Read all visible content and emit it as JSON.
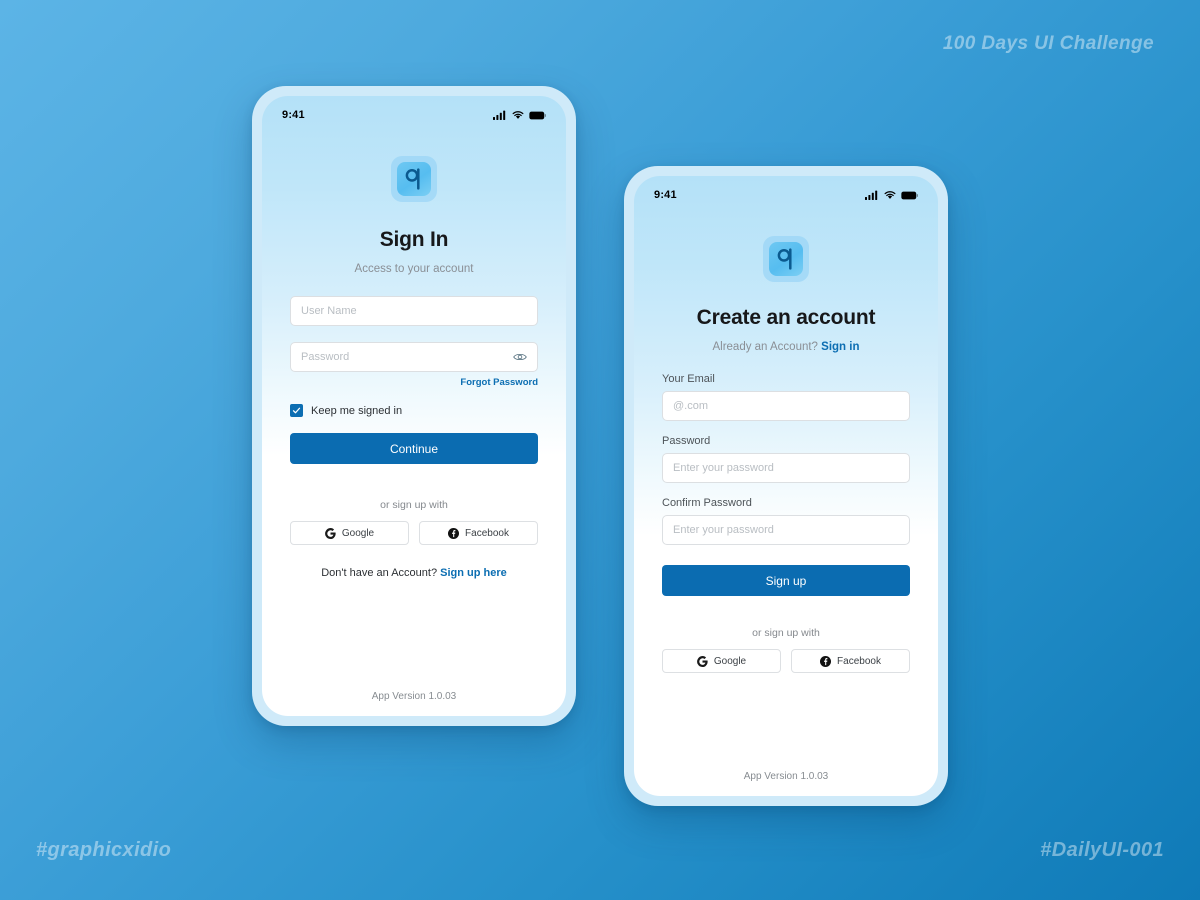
{
  "watermarks": {
    "top_right": "100 Days UI Challenge",
    "bottom_left": "#graphicxidio",
    "bottom_right": "#DailyUI-001"
  },
  "colors": {
    "background_from": "#5cb4e6",
    "background_to": "#0f7ab7",
    "accent": "#0b6cb1",
    "link": "#0c6eb2",
    "bezel": "#cfeaf9",
    "logo_tile": "#56bdf0",
    "logo_glyph": "#0b5a8f",
    "placeholder": "#b9bec3"
  },
  "signin": {
    "status": {
      "time": "9:41",
      "cellular_icon": "signal-bars-icon",
      "wifi_icon": "wifi-icon",
      "battery_icon": "battery-icon"
    },
    "logo_icon": "app-logo-icon",
    "title": "Sign In",
    "subtitle": "Access to your account",
    "username": {
      "placeholder": "User Name",
      "value": ""
    },
    "password": {
      "placeholder": "Password",
      "value": "",
      "toggle_icon": "eye-icon"
    },
    "forgot_label": "Forgot Password",
    "remember": {
      "label": "Keep me signed in",
      "checked": true,
      "check_icon": "check-icon"
    },
    "submit_label": "Continue",
    "divider_label": "or sign up with",
    "social": [
      {
        "label": "Google",
        "icon": "google-icon"
      },
      {
        "label": "Facebook",
        "icon": "facebook-icon"
      }
    ],
    "cta_text": "Don't have an Account?",
    "cta_link": "Sign up here",
    "version": "App Version 1.0.03"
  },
  "signup": {
    "status": {
      "time": "9:41",
      "cellular_icon": "signal-bars-icon",
      "wifi_icon": "wifi-icon",
      "battery_icon": "battery-icon"
    },
    "logo_icon": "app-logo-icon",
    "title": "Create an account",
    "subtitle_text": "Already an Account?",
    "subtitle_link": "Sign in",
    "email": {
      "label": "Your Email",
      "placeholder": "@.com",
      "value": ""
    },
    "password": {
      "label": "Password",
      "placeholder": "Enter your password",
      "value": ""
    },
    "confirm": {
      "label": "Confirm Password",
      "placeholder": "Enter your password",
      "value": ""
    },
    "submit_label": "Sign up",
    "divider_label": "or sign up with",
    "social": [
      {
        "label": "Google",
        "icon": "google-icon"
      },
      {
        "label": "Facebook",
        "icon": "facebook-icon"
      }
    ],
    "version": "App Version 1.0.03"
  }
}
